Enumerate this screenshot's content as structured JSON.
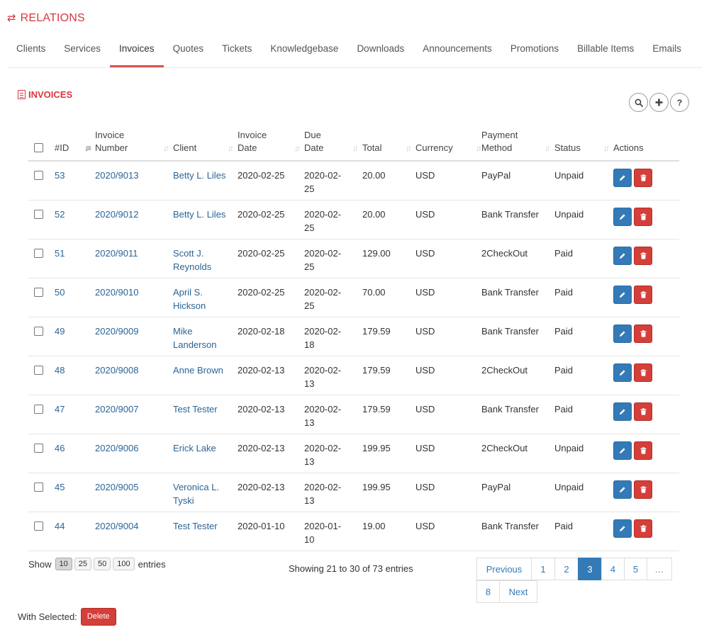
{
  "header": {
    "icon": "⇄",
    "title": "RELATIONS"
  },
  "tabs": [
    {
      "label": "Clients",
      "active": false
    },
    {
      "label": "Services",
      "active": false
    },
    {
      "label": "Invoices",
      "active": true
    },
    {
      "label": "Quotes",
      "active": false
    },
    {
      "label": "Tickets",
      "active": false
    },
    {
      "label": "Knowledgebase",
      "active": false
    },
    {
      "label": "Downloads",
      "active": false
    },
    {
      "label": "Announcements",
      "active": false
    },
    {
      "label": "Promotions",
      "active": false
    },
    {
      "label": "Billable Items",
      "active": false
    },
    {
      "label": "Emails",
      "active": false
    }
  ],
  "section": {
    "title": "INVOICES",
    "tools": [
      "search-icon",
      "plus-icon",
      "help-icon"
    ]
  },
  "table": {
    "columns": [
      "#ID",
      "Invoice Number",
      "Client",
      "Invoice Date",
      "Due Date",
      "Total",
      "Currency",
      "Payment Method",
      "Status",
      "Actions"
    ],
    "rows": [
      {
        "id": "53",
        "number": "2020/9013",
        "client": "Betty L. Liles",
        "invoice_date": "2020-02-25",
        "due_date": "2020-02-25",
        "total": "20.00",
        "currency": "USD",
        "method": "PayPal",
        "status": "Unpaid"
      },
      {
        "id": "52",
        "number": "2020/9012",
        "client": "Betty L. Liles",
        "invoice_date": "2020-02-25",
        "due_date": "2020-02-25",
        "total": "20.00",
        "currency": "USD",
        "method": "Bank Transfer",
        "status": "Unpaid"
      },
      {
        "id": "51",
        "number": "2020/9011",
        "client": "Scott J. Reynolds",
        "invoice_date": "2020-02-25",
        "due_date": "2020-02-25",
        "total": "129.00",
        "currency": "USD",
        "method": "2CheckOut",
        "status": "Paid"
      },
      {
        "id": "50",
        "number": "2020/9010",
        "client": "April S. Hickson",
        "invoice_date": "2020-02-25",
        "due_date": "2020-02-25",
        "total": "70.00",
        "currency": "USD",
        "method": "Bank Transfer",
        "status": "Paid"
      },
      {
        "id": "49",
        "number": "2020/9009",
        "client": "Mike Landerson",
        "invoice_date": "2020-02-18",
        "due_date": "2020-02-18",
        "total": "179.59",
        "currency": "USD",
        "method": "Bank Transfer",
        "status": "Paid"
      },
      {
        "id": "48",
        "number": "2020/9008",
        "client": "Anne Brown",
        "invoice_date": "2020-02-13",
        "due_date": "2020-02-13",
        "total": "179.59",
        "currency": "USD",
        "method": "2CheckOut",
        "status": "Paid"
      },
      {
        "id": "47",
        "number": "2020/9007",
        "client": "Test Tester",
        "invoice_date": "2020-02-13",
        "due_date": "2020-02-13",
        "total": "179.59",
        "currency": "USD",
        "method": "Bank Transfer",
        "status": "Paid"
      },
      {
        "id": "46",
        "number": "2020/9006",
        "client": "Erick Lake",
        "invoice_date": "2020-02-13",
        "due_date": "2020-02-13",
        "total": "199.95",
        "currency": "USD",
        "method": "2CheckOut",
        "status": "Unpaid"
      },
      {
        "id": "45",
        "number": "2020/9005",
        "client": "Veronica L. Tyski",
        "invoice_date": "2020-02-13",
        "due_date": "2020-02-13",
        "total": "199.95",
        "currency": "USD",
        "method": "PayPal",
        "status": "Unpaid"
      },
      {
        "id": "44",
        "number": "2020/9004",
        "client": "Test Tester",
        "invoice_date": "2020-01-10",
        "due_date": "2020-01-10",
        "total": "19.00",
        "currency": "USD",
        "method": "Bank Transfer",
        "status": "Paid"
      }
    ]
  },
  "length_menu": {
    "show_label": "Show",
    "options": [
      "10",
      "25",
      "50",
      "100"
    ],
    "selected": "10",
    "entries_label": "entries"
  },
  "info": "Showing 21 to 30 of 73 entries",
  "pagination": {
    "previous": "Previous",
    "pages": [
      "1",
      "2",
      "3",
      "4",
      "5",
      "…",
      "8"
    ],
    "current": "3",
    "next": "Next"
  },
  "bulk": {
    "label": "With Selected:",
    "delete": "Delete"
  },
  "colors": {
    "brand_red": "#d9363e",
    "link_blue": "#2a6496",
    "primary": "#337ab7",
    "danger": "#d43f3a"
  }
}
